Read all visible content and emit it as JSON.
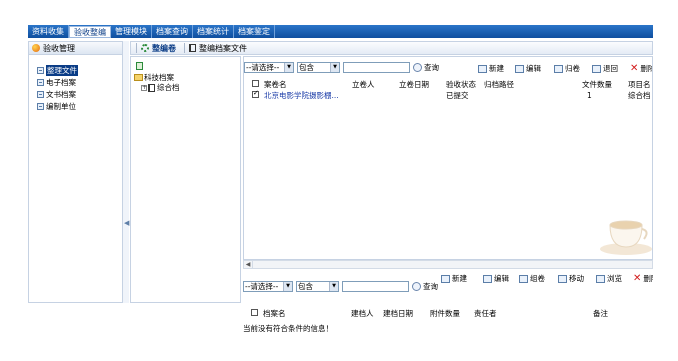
{
  "topnav": {
    "tabs": [
      {
        "label": "资料收集",
        "active": false
      },
      {
        "label": "验收整编",
        "active": true
      },
      {
        "label": "管理模块",
        "active": false
      },
      {
        "label": "档案查询",
        "active": false
      },
      {
        "label": "档案统计",
        "active": false
      },
      {
        "label": "档案鉴定",
        "active": false
      }
    ]
  },
  "sidebar": {
    "title": "验收管理",
    "items": [
      {
        "label": "整理文件",
        "selected": true
      },
      {
        "label": "电子档案",
        "selected": false
      },
      {
        "label": "文书档案",
        "selected": false
      },
      {
        "label": "编制单位",
        "selected": false
      }
    ]
  },
  "main_toolbar": {
    "edit_label": "整编卷",
    "view_label": "整编档案文件"
  },
  "tree": {
    "root_label": "科技档案",
    "child_label": "综合档"
  },
  "upper": {
    "filter_select": "--请选择--",
    "operator_select": "包含",
    "search_label": "查询",
    "actions": {
      "new": "新建",
      "edit": "编辑",
      "archive": "归卷",
      "return": "退回",
      "delete": "删除"
    },
    "columns": [
      "案卷名",
      "立卷人",
      "立卷日期",
      "验收状态",
      "归档路径",
      "文件数量",
      "项目名"
    ],
    "rows": [
      {
        "checked": true,
        "name": "北京电影学院摄影棚...",
        "creator": "",
        "date": "",
        "status": "已提交",
        "path": "",
        "count": "1",
        "project": "综合档"
      }
    ]
  },
  "lower": {
    "filter_select": "--请选择--",
    "operator_select": "包含",
    "search_label": "查询",
    "actions": {
      "new": "新建",
      "edit": "编辑",
      "group": "组卷",
      "move": "移动",
      "browse": "浏览",
      "delete": "删除"
    },
    "columns": [
      "档案名",
      "建档人",
      "建档日期",
      "附件数量",
      "责任者",
      "备注"
    ],
    "empty_message": "当前没有符合条件的信息！"
  },
  "colors": {
    "nav_bg": "#0f4f9f",
    "accent": "#0a3c86",
    "link": "#1b3ca8",
    "delete": "#d21b1b"
  }
}
